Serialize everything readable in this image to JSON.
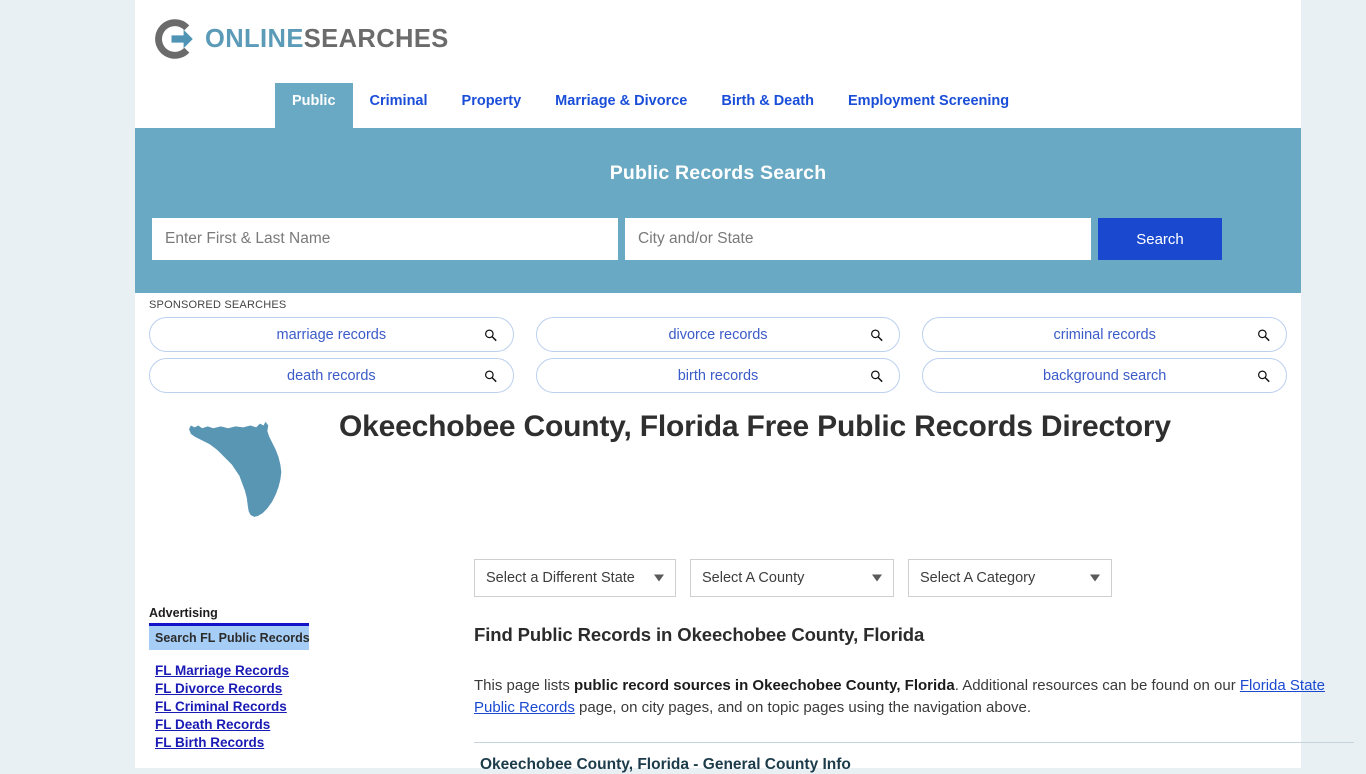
{
  "brand": {
    "name_part1": "ONLINE",
    "name_part2": "SEARCHES",
    "logo_icon": "circle-arrow-logo-icon",
    "accent_blue": "#5b9bb8",
    "accent_gray": "#6b6b6b"
  },
  "nav": {
    "items": [
      {
        "label": "Public",
        "active": true
      },
      {
        "label": "Criminal",
        "active": false
      },
      {
        "label": "Property",
        "active": false
      },
      {
        "label": "Marriage & Divorce",
        "active": false
      },
      {
        "label": "Birth & Death",
        "active": false
      },
      {
        "label": "Employment Screening",
        "active": false
      }
    ]
  },
  "hero": {
    "title": "Public Records Search",
    "name_placeholder": "Enter First & Last Name",
    "name_value": "",
    "city_placeholder": "City and/or State",
    "city_value": "",
    "search_label": "Search",
    "background": "#6aa9c3",
    "button_color": "#1a49d0"
  },
  "sponsored": {
    "label": "SPONSORED SEARCHES",
    "row1": [
      {
        "label": "marriage records",
        "icon": "search-icon"
      },
      {
        "label": "divorce records",
        "icon": "search-icon"
      },
      {
        "label": "criminal records",
        "icon": "search-icon"
      }
    ],
    "row2": [
      {
        "label": "death records",
        "icon": "search-icon"
      },
      {
        "label": "birth records",
        "icon": "search-icon"
      },
      {
        "label": "background search",
        "icon": "search-icon"
      }
    ]
  },
  "title_block": {
    "map_icon": "florida-state-map-icon",
    "map_color": "#5896b4",
    "heading": "Okeechobee County, Florida Free Public Records Directory"
  },
  "selects": {
    "state": "Select a Different State",
    "county": "Select A County",
    "category": "Select A Category"
  },
  "sidebar": {
    "advertising_label": "Advertising",
    "ad_box_label": "Search FL Public Records",
    "links": [
      "FL Marriage Records",
      "FL Divorce Records",
      "FL Criminal Records",
      "FL Death Records",
      "FL Birth Records"
    ]
  },
  "main": {
    "heading": "Find Public Records in Okeechobee County, Florida",
    "para_lead": "This page lists ",
    "para_bold": "public record sources in Okeechobee County, Florida",
    "para_mid": ". Additional resources can be found on our ",
    "para_link": "Florida State Public Records",
    "para_tail": " page, on city pages, and on topic pages using the navigation above.",
    "section_heading": "Okeechobee County, Florida - General County Info"
  }
}
